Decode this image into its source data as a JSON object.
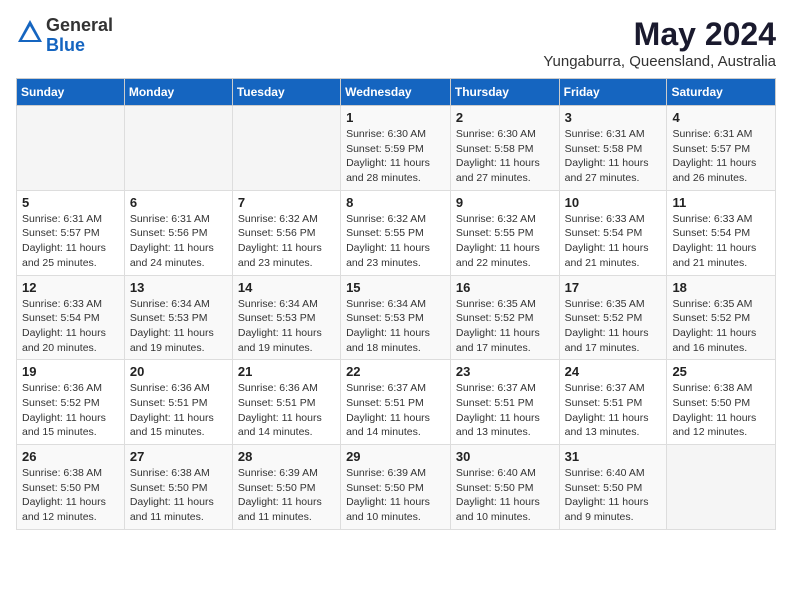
{
  "header": {
    "logo": {
      "general": "General",
      "blue": "Blue"
    },
    "title": "May 2024",
    "subtitle": "Yungaburra, Queensland, Australia"
  },
  "calendar": {
    "days_of_week": [
      "Sunday",
      "Monday",
      "Tuesday",
      "Wednesday",
      "Thursday",
      "Friday",
      "Saturday"
    ],
    "weeks": [
      [
        {
          "day": "",
          "info": ""
        },
        {
          "day": "",
          "info": ""
        },
        {
          "day": "",
          "info": ""
        },
        {
          "day": "1",
          "info": "Sunrise: 6:30 AM\nSunset: 5:59 PM\nDaylight: 11 hours and 28 minutes."
        },
        {
          "day": "2",
          "info": "Sunrise: 6:30 AM\nSunset: 5:58 PM\nDaylight: 11 hours and 27 minutes."
        },
        {
          "day": "3",
          "info": "Sunrise: 6:31 AM\nSunset: 5:58 PM\nDaylight: 11 hours and 27 minutes."
        },
        {
          "day": "4",
          "info": "Sunrise: 6:31 AM\nSunset: 5:57 PM\nDaylight: 11 hours and 26 minutes."
        }
      ],
      [
        {
          "day": "5",
          "info": "Sunrise: 6:31 AM\nSunset: 5:57 PM\nDaylight: 11 hours and 25 minutes."
        },
        {
          "day": "6",
          "info": "Sunrise: 6:31 AM\nSunset: 5:56 PM\nDaylight: 11 hours and 24 minutes."
        },
        {
          "day": "7",
          "info": "Sunrise: 6:32 AM\nSunset: 5:56 PM\nDaylight: 11 hours and 23 minutes."
        },
        {
          "day": "8",
          "info": "Sunrise: 6:32 AM\nSunset: 5:55 PM\nDaylight: 11 hours and 23 minutes."
        },
        {
          "day": "9",
          "info": "Sunrise: 6:32 AM\nSunset: 5:55 PM\nDaylight: 11 hours and 22 minutes."
        },
        {
          "day": "10",
          "info": "Sunrise: 6:33 AM\nSunset: 5:54 PM\nDaylight: 11 hours and 21 minutes."
        },
        {
          "day": "11",
          "info": "Sunrise: 6:33 AM\nSunset: 5:54 PM\nDaylight: 11 hours and 21 minutes."
        }
      ],
      [
        {
          "day": "12",
          "info": "Sunrise: 6:33 AM\nSunset: 5:54 PM\nDaylight: 11 hours and 20 minutes."
        },
        {
          "day": "13",
          "info": "Sunrise: 6:34 AM\nSunset: 5:53 PM\nDaylight: 11 hours and 19 minutes."
        },
        {
          "day": "14",
          "info": "Sunrise: 6:34 AM\nSunset: 5:53 PM\nDaylight: 11 hours and 19 minutes."
        },
        {
          "day": "15",
          "info": "Sunrise: 6:34 AM\nSunset: 5:53 PM\nDaylight: 11 hours and 18 minutes."
        },
        {
          "day": "16",
          "info": "Sunrise: 6:35 AM\nSunset: 5:52 PM\nDaylight: 11 hours and 17 minutes."
        },
        {
          "day": "17",
          "info": "Sunrise: 6:35 AM\nSunset: 5:52 PM\nDaylight: 11 hours and 17 minutes."
        },
        {
          "day": "18",
          "info": "Sunrise: 6:35 AM\nSunset: 5:52 PM\nDaylight: 11 hours and 16 minutes."
        }
      ],
      [
        {
          "day": "19",
          "info": "Sunrise: 6:36 AM\nSunset: 5:52 PM\nDaylight: 11 hours and 15 minutes."
        },
        {
          "day": "20",
          "info": "Sunrise: 6:36 AM\nSunset: 5:51 PM\nDaylight: 11 hours and 15 minutes."
        },
        {
          "day": "21",
          "info": "Sunrise: 6:36 AM\nSunset: 5:51 PM\nDaylight: 11 hours and 14 minutes."
        },
        {
          "day": "22",
          "info": "Sunrise: 6:37 AM\nSunset: 5:51 PM\nDaylight: 11 hours and 14 minutes."
        },
        {
          "day": "23",
          "info": "Sunrise: 6:37 AM\nSunset: 5:51 PM\nDaylight: 11 hours and 13 minutes."
        },
        {
          "day": "24",
          "info": "Sunrise: 6:37 AM\nSunset: 5:51 PM\nDaylight: 11 hours and 13 minutes."
        },
        {
          "day": "25",
          "info": "Sunrise: 6:38 AM\nSunset: 5:50 PM\nDaylight: 11 hours and 12 minutes."
        }
      ],
      [
        {
          "day": "26",
          "info": "Sunrise: 6:38 AM\nSunset: 5:50 PM\nDaylight: 11 hours and 12 minutes."
        },
        {
          "day": "27",
          "info": "Sunrise: 6:38 AM\nSunset: 5:50 PM\nDaylight: 11 hours and 11 minutes."
        },
        {
          "day": "28",
          "info": "Sunrise: 6:39 AM\nSunset: 5:50 PM\nDaylight: 11 hours and 11 minutes."
        },
        {
          "day": "29",
          "info": "Sunrise: 6:39 AM\nSunset: 5:50 PM\nDaylight: 11 hours and 10 minutes."
        },
        {
          "day": "30",
          "info": "Sunrise: 6:40 AM\nSunset: 5:50 PM\nDaylight: 11 hours and 10 minutes."
        },
        {
          "day": "31",
          "info": "Sunrise: 6:40 AM\nSunset: 5:50 PM\nDaylight: 11 hours and 9 minutes."
        },
        {
          "day": "",
          "info": ""
        }
      ]
    ]
  }
}
